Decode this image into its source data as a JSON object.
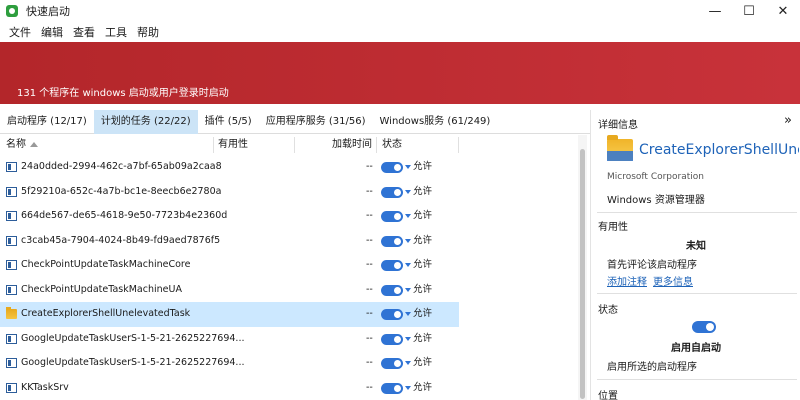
{
  "window": {
    "title": "快速启动",
    "controls": {
      "minimize": "—",
      "maximize": "☐",
      "close": "✕"
    }
  },
  "menu": [
    "文件",
    "编辑",
    "查看",
    "工具",
    "帮助"
  ],
  "banner": {
    "text": "131 个程序在 windows 启动或用户登录时启动",
    "color": "#c0292e"
  },
  "tabs": [
    {
      "label": "启动程序 (12/17)",
      "active": false
    },
    {
      "label": "计划的任务 (22/22)",
      "active": true
    },
    {
      "label": "插件 (5/5)",
      "active": false
    },
    {
      "label": "应用程序服务 (31/56)",
      "active": false
    },
    {
      "label": "Windows服务 (61/249)",
      "active": false
    }
  ],
  "grid": {
    "columns": {
      "name": "名称",
      "usefulness": "有用性",
      "load_time": "加载时间",
      "status": "状态"
    },
    "rows": [
      {
        "name": "24a0dded-2994-462c-a7bf-65ab09a2caa8",
        "time": "--",
        "status": "允许",
        "icon": "task-icon",
        "selected": false
      },
      {
        "name": "5f29210a-652c-4a7b-bc1e-8eecb6e2780a",
        "time": "--",
        "status": "允许",
        "icon": "task-icon",
        "selected": false
      },
      {
        "name": "664de567-de65-4618-9e50-7723b4e2360d",
        "time": "--",
        "status": "允许",
        "icon": "task-icon",
        "selected": false
      },
      {
        "name": "c3cab45a-7904-4024-8b49-fd9aed7876f5",
        "time": "--",
        "status": "允许",
        "icon": "task-icon",
        "selected": false
      },
      {
        "name": "CheckPointUpdateTaskMachineCore",
        "time": "--",
        "status": "允许",
        "icon": "task-icon",
        "selected": false
      },
      {
        "name": "CheckPointUpdateTaskMachineUA",
        "time": "--",
        "status": "允许",
        "icon": "task-icon",
        "selected": false
      },
      {
        "name": "CreateExplorerShellUnelevatedTask",
        "time": "--",
        "status": "允许",
        "icon": "folder-icon",
        "selected": true
      },
      {
        "name": "GoogleUpdateTaskUserS-1-5-21-2625227694...",
        "time": "--",
        "status": "允许",
        "icon": "task-icon",
        "selected": false
      },
      {
        "name": "GoogleUpdateTaskUserS-1-5-21-2625227694...",
        "time": "--",
        "status": "允许",
        "icon": "task-icon",
        "selected": false
      },
      {
        "name": "KKTaskSrv",
        "time": "--",
        "status": "允许",
        "icon": "task-icon",
        "selected": false
      }
    ]
  },
  "details": {
    "header": "详细信息",
    "collapse": "»",
    "app_name": "CreateExplorerShellUnelevatedTask",
    "company": "Microsoft Corporation",
    "description": "Windows 资源管理器",
    "usefulness_title": "有用性",
    "usefulness_value": "未知",
    "usefulness_prompt": "首先评论该启动程序",
    "add_comment": "添加注释",
    "more_info": "更多信息",
    "status_title": "状态",
    "status_value": "启用自启动",
    "status_desc": "启用所选的启动程序",
    "location_title": "位置"
  },
  "colors": {
    "accent": "#2f73d4",
    "selected_row": "#cce8ff",
    "active_tab": "#cce4f7",
    "link": "#1e63b8"
  }
}
